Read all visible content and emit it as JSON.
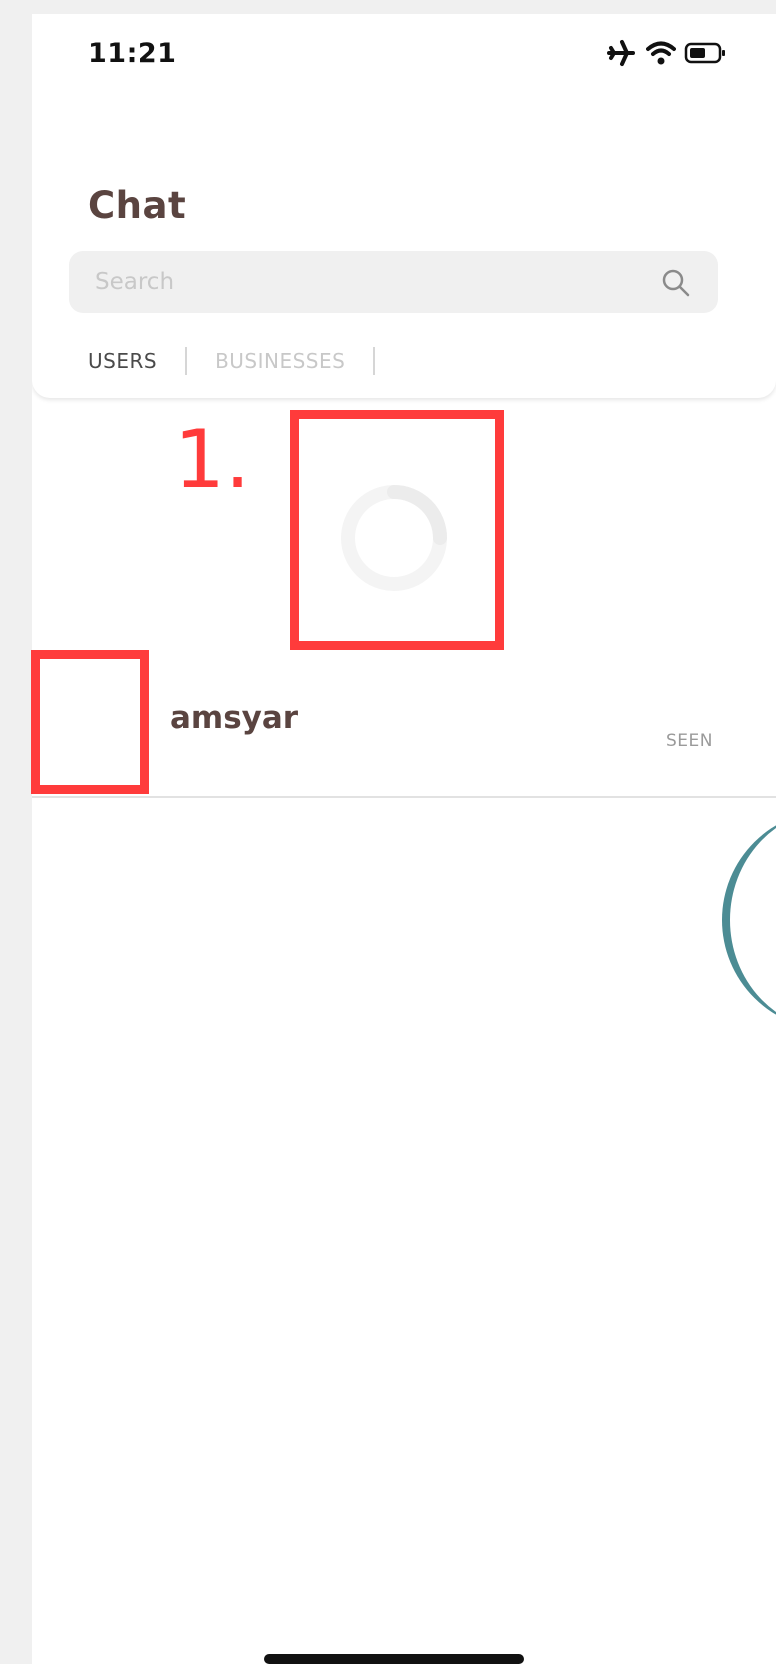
{
  "status_bar": {
    "time": "11:21",
    "icons": [
      "airplane-icon",
      "wifi-icon",
      "battery-icon"
    ]
  },
  "header": {
    "title": "Chat"
  },
  "search": {
    "placeholder": "Search",
    "value": ""
  },
  "tabs": [
    {
      "label": "USERS",
      "active": true
    },
    {
      "label": "BUSINESSES",
      "active": false
    }
  ],
  "annotations": {
    "label_1": "1.",
    "label_2": "."
  },
  "chat_list": [
    {
      "name": "amsyar",
      "status": "SEEN"
    }
  ],
  "colors": {
    "title": "#5a4440",
    "annotation": "#ff3b3b",
    "search_bg": "#f0f0f0",
    "fab_edge": "#4c8c94"
  }
}
